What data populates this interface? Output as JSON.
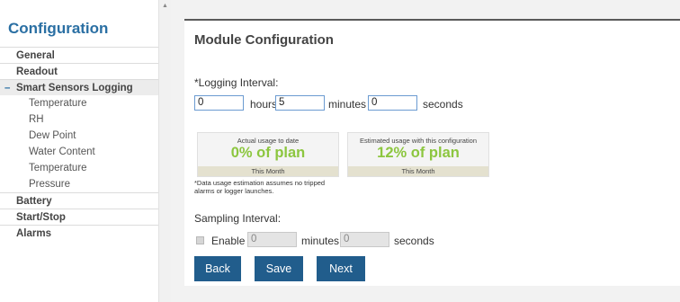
{
  "sidebar": {
    "title": "Configuration",
    "items": [
      {
        "label": "General"
      },
      {
        "label": "Readout"
      },
      {
        "label": "Smart Sensors Logging",
        "marker": "–"
      },
      {
        "label": "Battery"
      },
      {
        "label": "Start/Stop"
      },
      {
        "label": "Alarms"
      }
    ],
    "subitems": [
      "Temperature",
      "RH",
      "Dew Point",
      "Water Content",
      "Temperature",
      "Pressure"
    ]
  },
  "panel": {
    "title": "Module Configuration",
    "logging": {
      "label": "*Logging Interval:",
      "hours_value": "0",
      "hours_label": "hours",
      "minutes_value": "5",
      "minutes_label": "minutes",
      "seconds_value": "0",
      "seconds_label": "seconds"
    },
    "usage": {
      "actual": {
        "label": "Actual usage to date",
        "value": "0% of plan",
        "footer": "This Month"
      },
      "estimated": {
        "label": "Estimated usage with this configuration",
        "value": "12% of plan",
        "footer": "This Month"
      },
      "note": "*Data usage estimation assumes no tripped alarms or logger launches."
    },
    "sampling": {
      "label": "Sampling Interval:",
      "enable_label": "Enable",
      "minutes_value": "0",
      "minutes_label": "minutes",
      "seconds_value": "0",
      "seconds_label": "seconds"
    },
    "buttons": {
      "back": "Back",
      "save": "Save",
      "next": "Next"
    }
  },
  "colors": {
    "accent": "#2a6fa3",
    "button": "#215d8c",
    "usage_green": "#8cc63f"
  }
}
